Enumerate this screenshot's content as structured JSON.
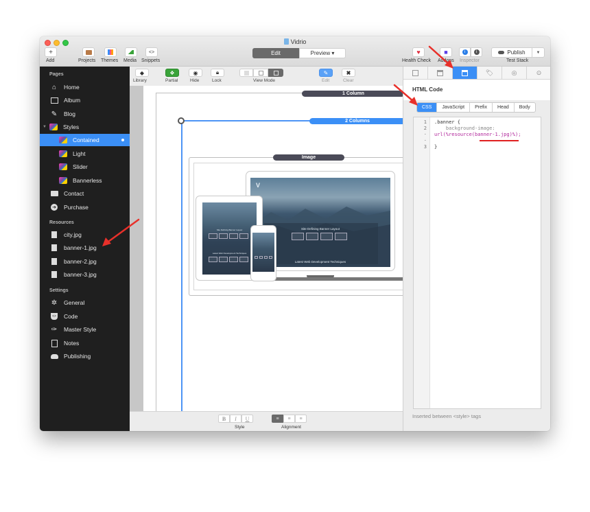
{
  "window": {
    "title": "Vidrio"
  },
  "toolbar": {
    "add": {
      "label": "Add",
      "icon": "+"
    },
    "projects": {
      "label": "Projects"
    },
    "themes": {
      "label": "Themes"
    },
    "media": {
      "label": "Media"
    },
    "snippets": {
      "label": "Snippets",
      "icon": "<>"
    },
    "mode": {
      "edit": "Edit",
      "preview": "Preview ▾"
    },
    "health_check": {
      "label": "Health Check"
    },
    "addons": {
      "label": "Addons"
    },
    "inspector": {
      "label": "Inspector"
    },
    "publish": {
      "label": "Publish",
      "dropdown": "▼"
    },
    "test_stack": {
      "label": "Test Stack"
    }
  },
  "sidebar": {
    "pages_header": "Pages",
    "pages": [
      {
        "label": "Home",
        "icon": "home-icon"
      },
      {
        "label": "Album",
        "icon": "album-icon"
      },
      {
        "label": "Blog",
        "icon": "pencil-icon"
      },
      {
        "label": "Styles",
        "icon": "styles-icon",
        "expanded": true
      },
      {
        "label": "Contained",
        "icon": "styles-icon",
        "selected": true
      },
      {
        "label": "Light",
        "icon": "styles-icon"
      },
      {
        "label": "Slider",
        "icon": "styles-icon"
      },
      {
        "label": "Bannerless",
        "icon": "styles-icon"
      },
      {
        "label": "Contact",
        "icon": "contact-icon"
      },
      {
        "label": "Purchase",
        "icon": "purchase-icon"
      }
    ],
    "resources_header": "Resources",
    "resources": [
      {
        "label": "city.jpg"
      },
      {
        "label": "banner-1.jpg"
      },
      {
        "label": "banner-2.jpg"
      },
      {
        "label": "banner-3.jpg"
      }
    ],
    "settings_header": "Settings",
    "settings": [
      {
        "label": "General",
        "icon": "gear-icon"
      },
      {
        "label": "Code",
        "icon": "code-icon"
      },
      {
        "label": "Master Style",
        "icon": "brush-icon"
      },
      {
        "label": "Notes",
        "icon": "notes-icon"
      },
      {
        "label": "Publishing",
        "icon": "cloud-icon"
      }
    ]
  },
  "canvas_toolbar": {
    "library": "Library",
    "partial": "Partial",
    "hide": "Hide",
    "lock": "Lock",
    "view_mode": "View Mode",
    "edit": "Edit",
    "clear": "Clear"
  },
  "canvas": {
    "labels": {
      "one_column": "1 Column",
      "two_columns": "2 Columns",
      "image": "Image"
    },
    "mockup": {
      "heading": "Site Defining Banner Layout",
      "subheading": "Latest Web Development Techniques"
    }
  },
  "format_bar": {
    "style_label": "Style",
    "alignment_label": "Alignment",
    "bold": "B",
    "italic": "I",
    "underline": "U",
    "align_left": "≡",
    "align_center": "≡",
    "align_right": "≡"
  },
  "inspector": {
    "title": "HTML Code",
    "code_tabs": [
      "CSS",
      "JavaScript",
      "Prefix",
      "Head",
      "Body"
    ],
    "selected_tab": "CSS",
    "code_lines": [
      {
        "num": "1",
        "text": ".banner {"
      },
      {
        "num": "2",
        "text": "    background-image:"
      },
      {
        "num": "·",
        "text": "url(%resource(banner-1.jpg)%);"
      },
      {
        "num": "·",
        "text": ""
      },
      {
        "num": "3",
        "text": "}"
      }
    ],
    "footer": "Inserted between <style> tags"
  },
  "colors": {
    "accent": "#3b8ff6",
    "sidebar_bg": "#1f1f1f",
    "annotation_arrow": "#e8302a"
  }
}
